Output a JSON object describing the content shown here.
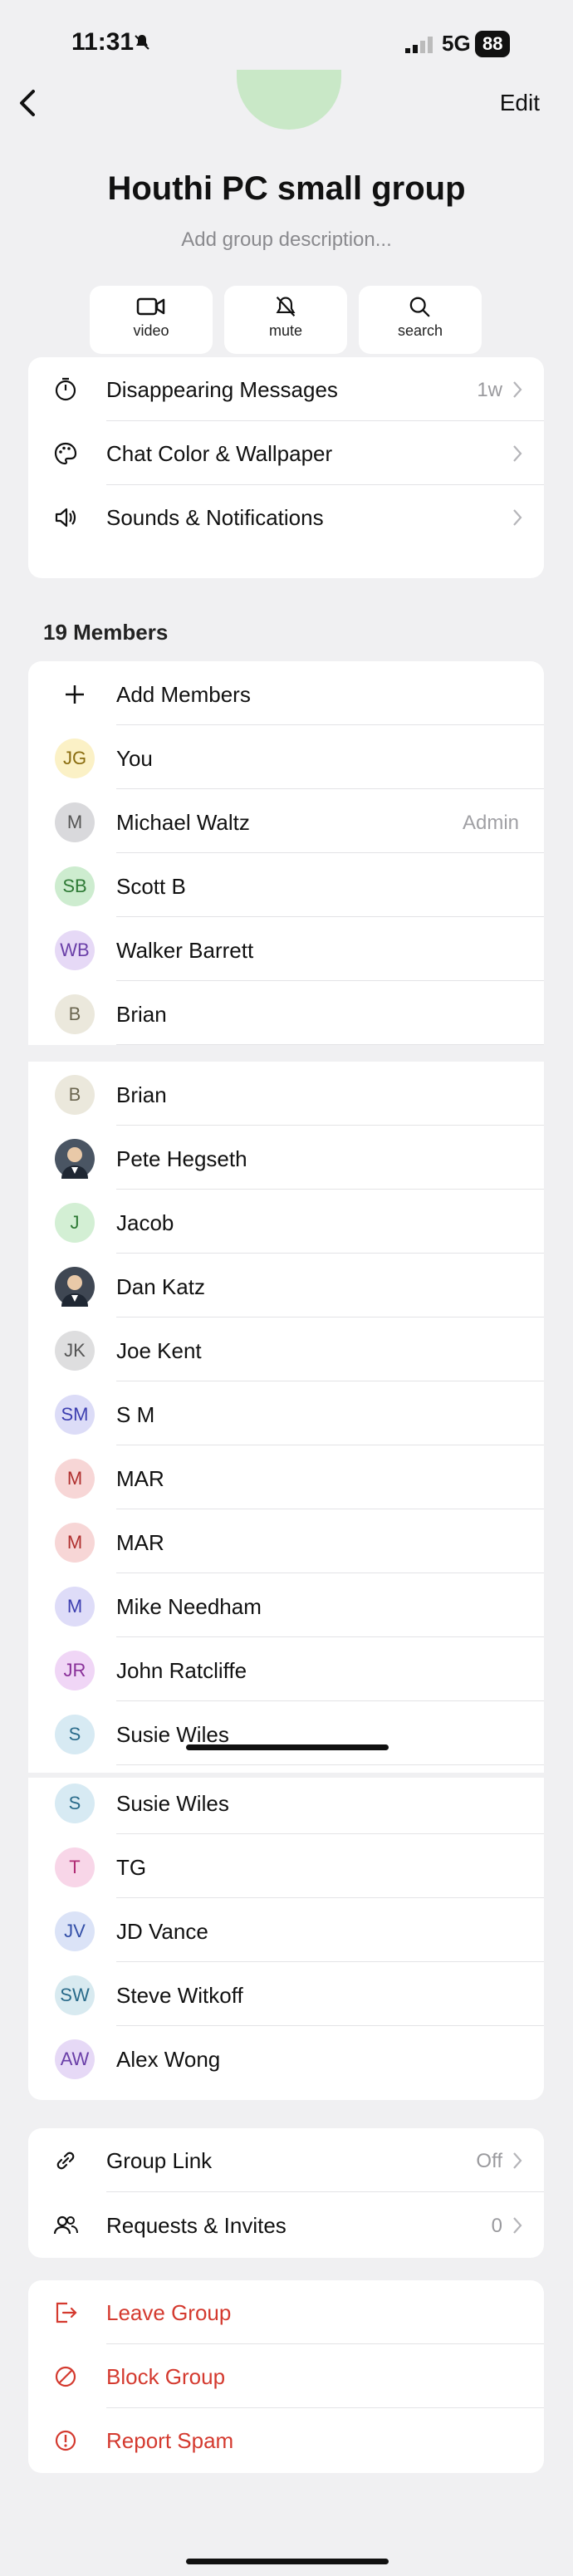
{
  "status_bar": {
    "time": "11:31",
    "network": "5G",
    "battery": "88"
  },
  "nav": {
    "edit_label": "Edit"
  },
  "group": {
    "name": "Houthi PC small group",
    "description_placeholder": "Add group description..."
  },
  "actions": [
    {
      "icon": "video-icon",
      "label": "video"
    },
    {
      "icon": "mute-icon",
      "label": "mute"
    },
    {
      "icon": "search-icon",
      "label": "search"
    }
  ],
  "settings": [
    {
      "icon": "timer-icon",
      "label": "Disappearing Messages",
      "value": "1w"
    },
    {
      "icon": "palette-icon",
      "label": "Chat Color & Wallpaper",
      "value": ""
    },
    {
      "icon": "speaker-icon",
      "label": "Sounds & Notifications",
      "value": ""
    }
  ],
  "members_header": "19 Members",
  "add_members_label": "Add Members",
  "members": [
    {
      "initials": "JG",
      "name": "You",
      "role": "",
      "bg": "#fbf1c6",
      "fg": "#8a6d10"
    },
    {
      "initials": "M",
      "name": "Michael Waltz",
      "role": "Admin",
      "bg": "#d9d9dc",
      "fg": "#555555"
    },
    {
      "initials": "SB",
      "name": "Scott B",
      "role": "",
      "bg": "#cdeccf",
      "fg": "#2e7a35"
    },
    {
      "initials": "WB",
      "name": "Walker Barrett",
      "role": "",
      "bg": "#e6d9f6",
      "fg": "#6a3fa8"
    },
    {
      "initials": "B",
      "name": "Brian",
      "role": "",
      "bg": "#ebe8dc",
      "fg": "#6b6650"
    },
    {
      "initials": "B",
      "name": "Brian",
      "role": "",
      "bg": "#ebe8dc",
      "fg": "#6b6650"
    },
    {
      "initials": "",
      "name": "Pete Hegseth",
      "role": "",
      "bg": "#4a5563",
      "fg": "#ffffff"
    },
    {
      "initials": "J",
      "name": "Jacob",
      "role": "",
      "bg": "#d3efd4",
      "fg": "#2e7a35"
    },
    {
      "initials": "",
      "name": "Dan Katz",
      "role": "",
      "bg": "#3f4753",
      "fg": "#ffffff"
    },
    {
      "initials": "JK",
      "name": "Joe Kent",
      "role": "",
      "bg": "#dededf",
      "fg": "#555555"
    },
    {
      "initials": "SM",
      "name": "S M",
      "role": "",
      "bg": "#dcdcf7",
      "fg": "#3d3fb0"
    },
    {
      "initials": "M",
      "name": "MAR",
      "role": "",
      "bg": "#f7d6d6",
      "fg": "#b0302f"
    },
    {
      "initials": "M",
      "name": "MAR",
      "role": "",
      "bg": "#f7d6d6",
      "fg": "#b0302f"
    },
    {
      "initials": "M",
      "name": "Mike Needham",
      "role": "",
      "bg": "#dedcf8",
      "fg": "#3d3fb0"
    },
    {
      "initials": "JR",
      "name": "John Ratcliffe",
      "role": "",
      "bg": "#f0d6f6",
      "fg": "#8a3099"
    },
    {
      "initials": "S",
      "name": "Susie Wiles",
      "role": "",
      "bg": "#d7eaf3",
      "fg": "#2a6b8a"
    },
    {
      "initials": "S",
      "name": "Susie Wiles",
      "role": "",
      "bg": "#d7eaf3",
      "fg": "#2a6b8a"
    },
    {
      "initials": "T",
      "name": "TG",
      "role": "",
      "bg": "#f8d6e8",
      "fg": "#b02c74"
    },
    {
      "initials": "JV",
      "name": "JD Vance",
      "role": "",
      "bg": "#dbe3f7",
      "fg": "#3450a8"
    },
    {
      "initials": "SW",
      "name": "Steve Witkoff",
      "role": "",
      "bg": "#d8eaf0",
      "fg": "#2a6b8a"
    },
    {
      "initials": "AW",
      "name": "Alex Wong",
      "role": "",
      "bg": "#e6d9f6",
      "fg": "#6a3fa8"
    }
  ],
  "link_section": [
    {
      "icon": "link-icon",
      "label": "Group Link",
      "value": "Off"
    },
    {
      "icon": "people-icon",
      "label": "Requests & Invites",
      "value": "0"
    }
  ],
  "danger_section": [
    {
      "icon": "leave-icon",
      "label": "Leave Group"
    },
    {
      "icon": "block-icon",
      "label": "Block Group"
    },
    {
      "icon": "report-icon",
      "label": "Report Spam"
    }
  ],
  "colors": {
    "danger": "#d43a2f",
    "background": "#f0f0f2",
    "card": "#ffffff"
  }
}
